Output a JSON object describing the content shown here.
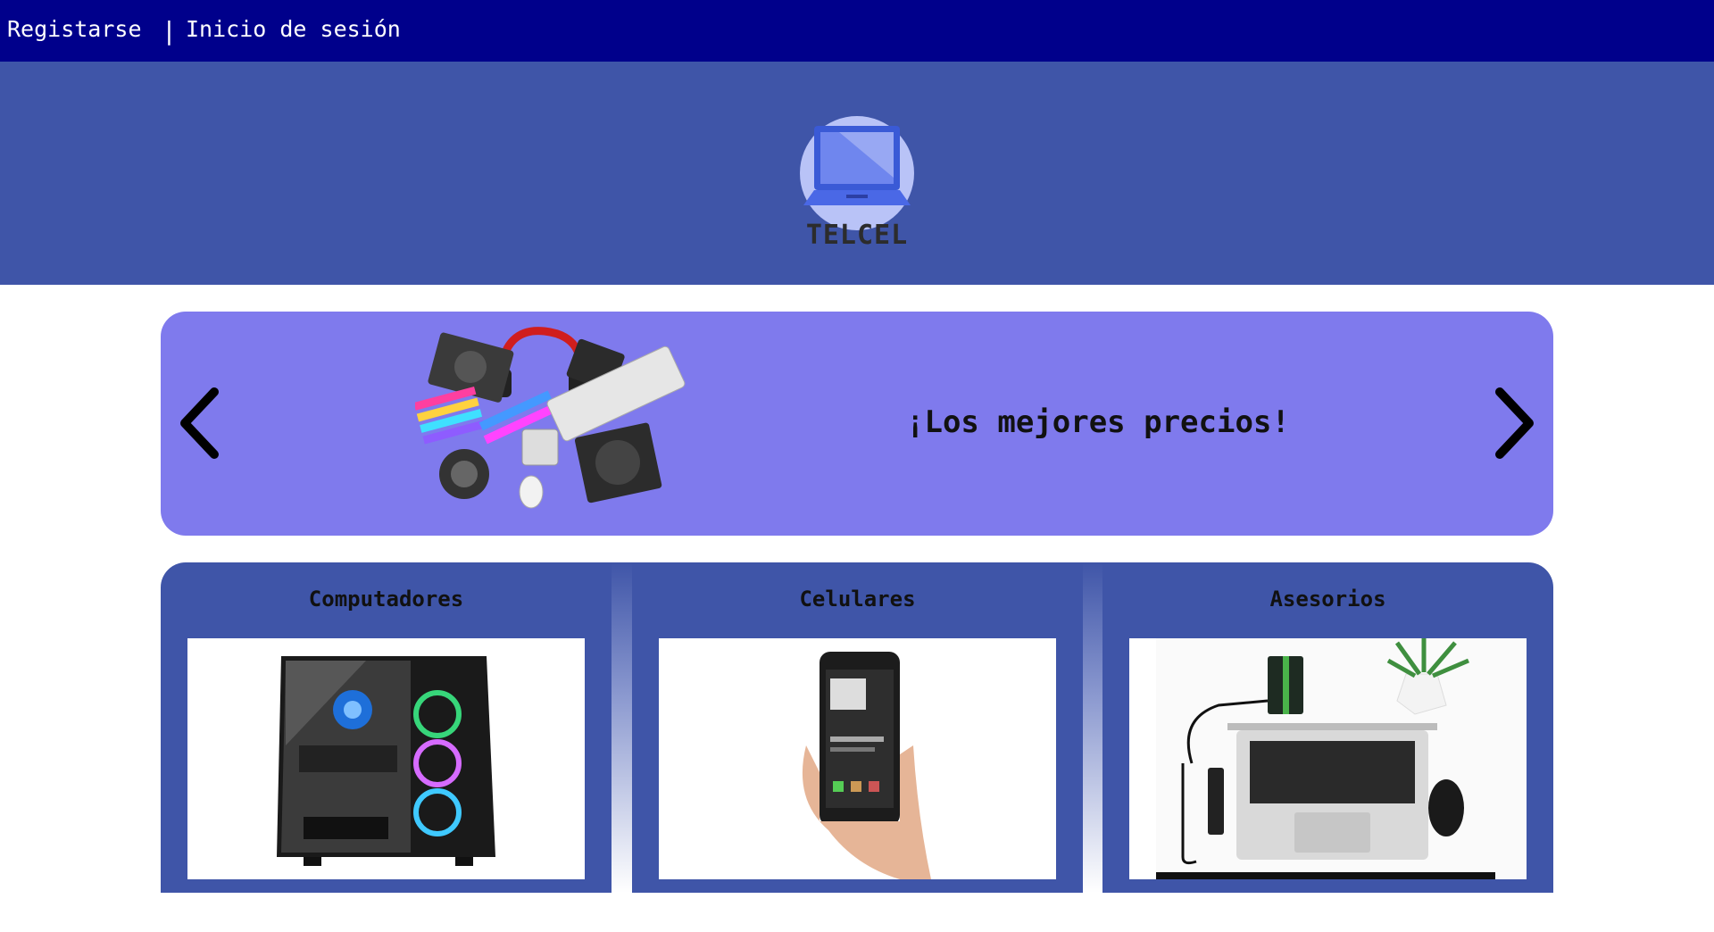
{
  "nav": {
    "register_label": "Registarse",
    "separator": "|",
    "login_label": "Inicio de sesión"
  },
  "header": {
    "logo_icon": "laptop-logo-icon",
    "logo_text": "TELCEL"
  },
  "banner": {
    "text": "¡Los mejores precios!",
    "prev_icon": "chevron-left-icon",
    "next_icon": "chevron-right-icon"
  },
  "categories": [
    {
      "title": "Computadores",
      "image": "gaming-pc-image"
    },
    {
      "title": "Celulares",
      "image": "smartphone-in-hand-image"
    },
    {
      "title": "Asesorios",
      "image": "laptop-accessories-image"
    }
  ],
  "colors": {
    "topbar": "#00008b",
    "header": "#3f55a8",
    "banner": "#7f7aed",
    "card": "#3f55a8"
  }
}
